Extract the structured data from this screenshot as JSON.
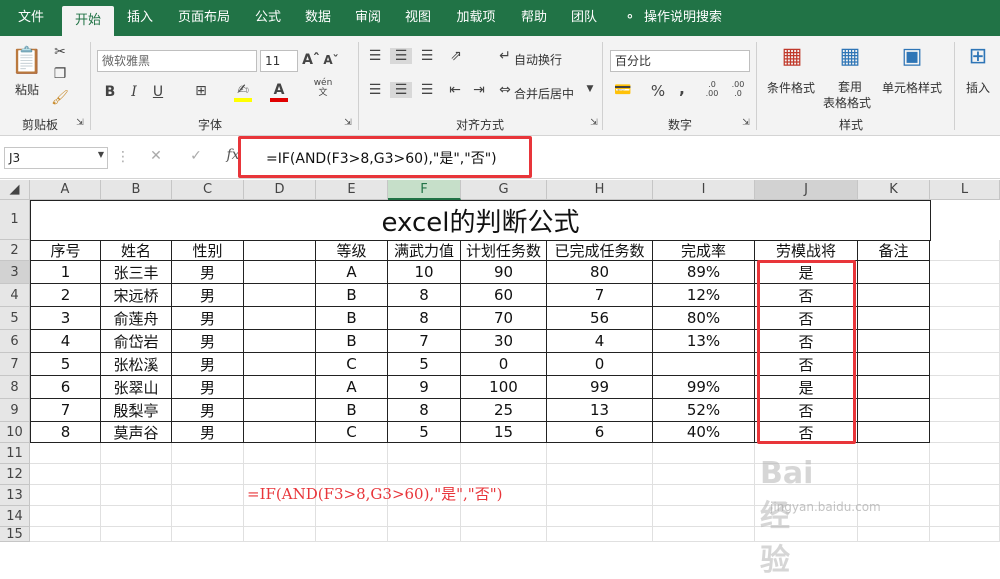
{
  "tabs": [
    "文件",
    "开始",
    "插入",
    "页面布局",
    "公式",
    "数据",
    "审阅",
    "视图",
    "加载项",
    "帮助",
    "团队",
    "操作说明搜索"
  ],
  "ribbon": {
    "clipboard": {
      "paste": "粘贴",
      "group": "剪贴板"
    },
    "font": {
      "name": "微软雅黑",
      "size": "11",
      "group": "字体",
      "wen": "wén",
      "wen_char": "文"
    },
    "alignment": {
      "wrap": "自动换行",
      "merge": "合并后居中",
      "group": "对齐方式"
    },
    "number": {
      "format": "百分比",
      "group": "数字",
      "percent": "%",
      "comma": ","
    },
    "styles": {
      "cond": "条件格式",
      "table1": "套用",
      "table2": "表格格式",
      "cell": "单元格样式",
      "group": "样式"
    },
    "cells": {
      "insert": "插入"
    }
  },
  "formula_bar": {
    "name_box": "J3",
    "fx": "fx",
    "formula": "=IF(AND(F3>8,G3>60),\"是\",\"否\")"
  },
  "columns": [
    "A",
    "B",
    "C",
    "D",
    "E",
    "F",
    "G",
    "H",
    "I",
    "J",
    "K",
    "L"
  ],
  "rows": [
    "1",
    "2",
    "3",
    "4",
    "5",
    "6",
    "7",
    "8",
    "9",
    "10",
    "11",
    "12",
    "13",
    "14",
    "15"
  ],
  "sheet": {
    "title": "excel的判断公式",
    "headers": [
      "序号",
      "姓名",
      "性别",
      "",
      "等级",
      "满武力值",
      "计划任务数",
      "已完成任务数",
      "完成率",
      "劳模战将",
      "备注"
    ],
    "data": [
      [
        "1",
        "张三丰",
        "男",
        "",
        "A",
        "10",
        "90",
        "80",
        "89%",
        "是",
        ""
      ],
      [
        "2",
        "宋远桥",
        "男",
        "",
        "B",
        "8",
        "60",
        "7",
        "12%",
        "否",
        ""
      ],
      [
        "3",
        "俞莲舟",
        "男",
        "",
        "B",
        "8",
        "70",
        "56",
        "80%",
        "否",
        ""
      ],
      [
        "4",
        "俞岱岩",
        "男",
        "",
        "B",
        "7",
        "30",
        "4",
        "13%",
        "否",
        ""
      ],
      [
        "5",
        "张松溪",
        "男",
        "",
        "C",
        "5",
        "0",
        "0",
        "",
        "否",
        ""
      ],
      [
        "6",
        "张翠山",
        "男",
        "",
        "A",
        "9",
        "100",
        "99",
        "99%",
        "是",
        ""
      ],
      [
        "7",
        "殷梨亭",
        "男",
        "",
        "B",
        "8",
        "25",
        "13",
        "52%",
        "否",
        ""
      ],
      [
        "8",
        "莫声谷",
        "男",
        "",
        "C",
        "5",
        "15",
        "6",
        "40%",
        "否",
        ""
      ]
    ],
    "note_formula": "=IF(AND(F3>8,G3>60),\"是\",\"否\")"
  },
  "watermark": {
    "text": "Bai经验",
    "url": "jingyan.baidu.com"
  },
  "colors": {
    "excel_green": "#217346",
    "highlight_red": "#e8353a",
    "note_red": "#e8353a"
  }
}
